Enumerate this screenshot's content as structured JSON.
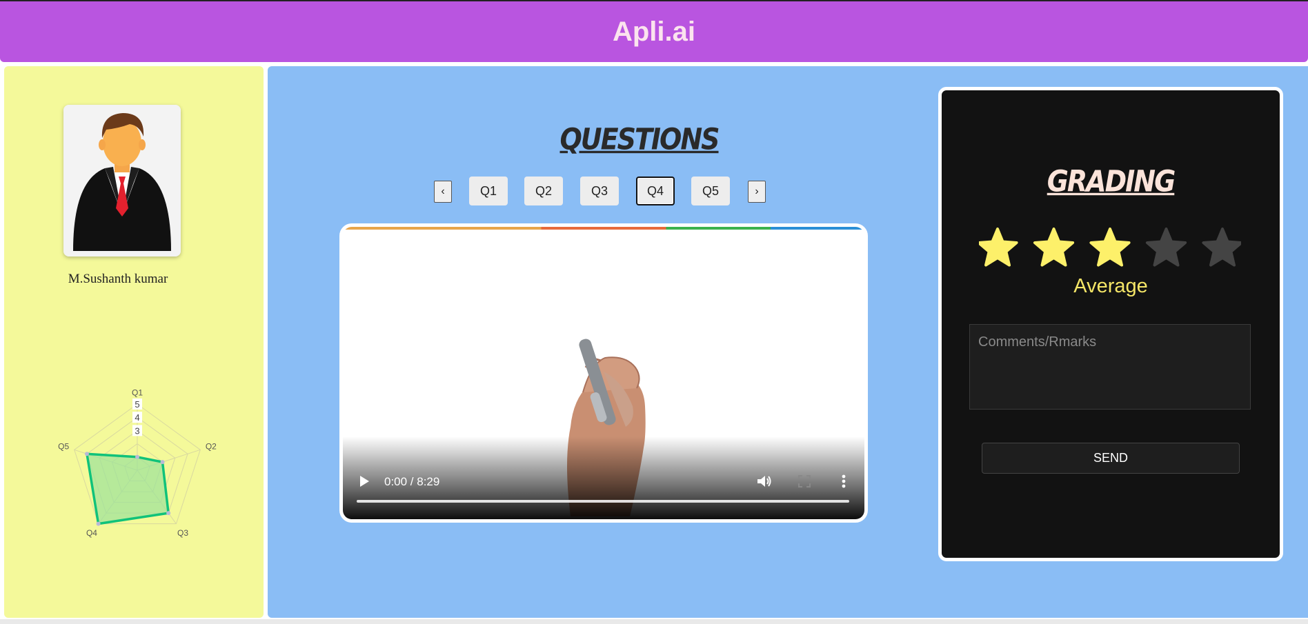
{
  "app": {
    "title": "Apli.ai"
  },
  "candidate": {
    "name": "M.Sushanth kumar"
  },
  "radar": {
    "axes": [
      "Q1",
      "Q2",
      "Q3",
      "Q4",
      "Q5"
    ],
    "scale_labels": [
      "3",
      "4",
      "5"
    ],
    "scale_max": 5,
    "values": [
      1,
      2,
      4,
      5,
      4
    ],
    "colors": {
      "line": "#10c27a",
      "fill": "#9be29a",
      "grid": "#d8d8a0"
    }
  },
  "questions": {
    "title": "QUESTIONS",
    "prev_label": "‹",
    "next_label": "›",
    "tabs": [
      "Q1",
      "Q2",
      "Q3",
      "Q4",
      "Q5"
    ],
    "active": "Q4"
  },
  "video": {
    "time": "0:00 / 8:29",
    "icons": [
      "play-icon",
      "volume-icon",
      "fullscreen-icon",
      "more-options-icon"
    ]
  },
  "grading": {
    "title": "GRADING",
    "rating": 3,
    "max_rating": 5,
    "rating_label": "Average",
    "comments_placeholder": "Comments/Rmarks",
    "comments_value": "",
    "send_label": "SEND",
    "colors": {
      "star_on": "#fdf06a",
      "star_off": "#444444",
      "label": "#f5e667"
    }
  }
}
